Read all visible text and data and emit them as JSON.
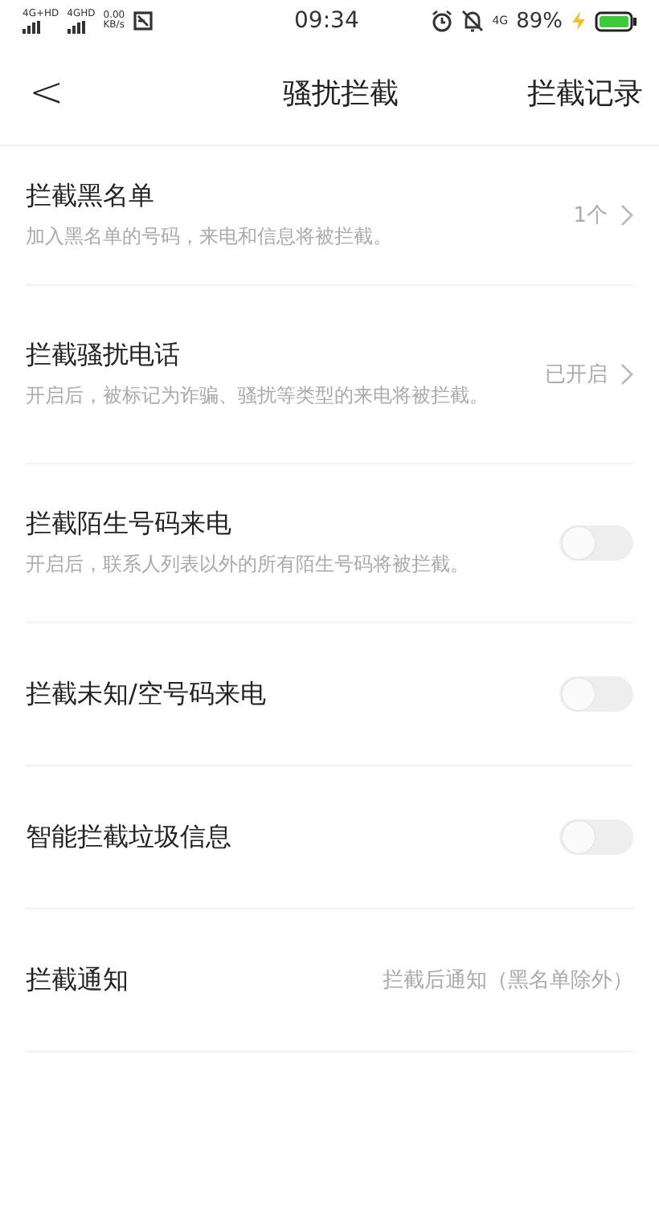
{
  "status_bar": {
    "sim_1": "4G+HD",
    "sim_2": "4GHD",
    "speed": "0.00",
    "speed_unit": "KB/s",
    "time": "09:34",
    "network": "4G",
    "battery": "89%",
    "charging": true
  },
  "header": {
    "back": "<",
    "title": "骚扰拦截",
    "action": "拦截记录"
  },
  "settings": [
    {
      "kind": "nav",
      "title": "拦截黑名单",
      "description": "加入黑名单的号码，来电和信息将被拦截。",
      "value": "1个"
    },
    {
      "kind": "nav",
      "title": "拦截骚扰电话",
      "description": "开启后，被标记为诈骗、骚扰等类型的来电将被拦截。",
      "value": "已开启"
    },
    {
      "kind": "toggle",
      "title": "拦截陌生号码来电",
      "description": "开启后，联系人列表以外的所有陌生号码将被拦截。",
      "on": false
    },
    {
      "kind": "toggle",
      "title": "拦截未知/空号码来电",
      "on": false
    },
    {
      "kind": "toggle",
      "title": "智能拦截垃圾信息",
      "on": false
    },
    {
      "kind": "value",
      "title": "拦截通知",
      "value": "拦截后通知（黑名单除外）"
    }
  ]
}
